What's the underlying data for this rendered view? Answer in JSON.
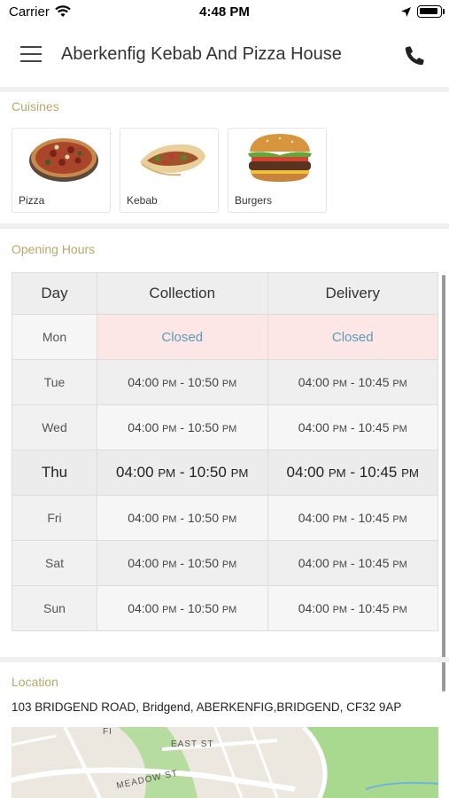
{
  "status_bar": {
    "carrier": "Carrier",
    "time": "4:48 PM",
    "icons": [
      "wifi-icon",
      "location-arrow-icon",
      "battery-icon"
    ]
  },
  "header": {
    "title": "Aberkenfig Kebab And Pizza House",
    "menu_icon": "menu-icon",
    "phone_icon": "phone-icon"
  },
  "cuisines": {
    "title": "Cuisines",
    "items": [
      {
        "label": "Pizza",
        "image": "pizza-image"
      },
      {
        "label": "Kebab",
        "image": "kebab-image"
      },
      {
        "label": "Burgers",
        "image": "burger-image"
      }
    ]
  },
  "opening_hours": {
    "title": "Opening Hours",
    "headers": {
      "day": "Day",
      "collection": "Collection",
      "delivery": "Delivery"
    },
    "rows": [
      {
        "day": "Mon",
        "collection": "Closed",
        "delivery": "Closed"
      },
      {
        "day": "Tue",
        "collection": {
          "start": "04:00",
          "start_ampm": "PM",
          "end": "10:50",
          "end_ampm": "PM"
        },
        "delivery": {
          "start": "04:00",
          "start_ampm": "PM",
          "end": "10:45",
          "end_ampm": "PM"
        }
      },
      {
        "day": "Wed",
        "collection": {
          "start": "04:00",
          "start_ampm": "PM",
          "end": "10:50",
          "end_ampm": "PM"
        },
        "delivery": {
          "start": "04:00",
          "start_ampm": "PM",
          "end": "10:45",
          "end_ampm": "PM"
        }
      },
      {
        "day": "Thu",
        "collection": {
          "start": "04:00",
          "start_ampm": "PM",
          "end": "10:50",
          "end_ampm": "PM"
        },
        "delivery": {
          "start": "04:00",
          "start_ampm": "PM",
          "end": "10:45",
          "end_ampm": "PM"
        }
      },
      {
        "day": "Fri",
        "collection": {
          "start": "04:00",
          "start_ampm": "PM",
          "end": "10:50",
          "end_ampm": "PM"
        },
        "delivery": {
          "start": "04:00",
          "start_ampm": "PM",
          "end": "10:45",
          "end_ampm": "PM"
        }
      },
      {
        "day": "Sat",
        "collection": {
          "start": "04:00",
          "start_ampm": "PM",
          "end": "10:50",
          "end_ampm": "PM"
        },
        "delivery": {
          "start": "04:00",
          "start_ampm": "PM",
          "end": "10:45",
          "end_ampm": "PM"
        }
      },
      {
        "day": "Sun",
        "collection": {
          "start": "04:00",
          "start_ampm": "PM",
          "end": "10:50",
          "end_ampm": "PM"
        },
        "delivery": {
          "start": "04:00",
          "start_ampm": "PM",
          "end": "10:45",
          "end_ampm": "PM"
        }
      }
    ]
  },
  "location": {
    "title": "Location",
    "address": "103 BRIDGEND ROAD, Bridgend, ABERKENFIG,BRIDGEND, CF32 9AP",
    "map_labels": {
      "street_1": "EAST ST",
      "street_2": "MEADOW ST",
      "street_3": "FI"
    }
  },
  "colors": {
    "section_title": "#b8a86a",
    "closed_bg": "#fde6e6",
    "closed_text": "#5a9bb6"
  }
}
